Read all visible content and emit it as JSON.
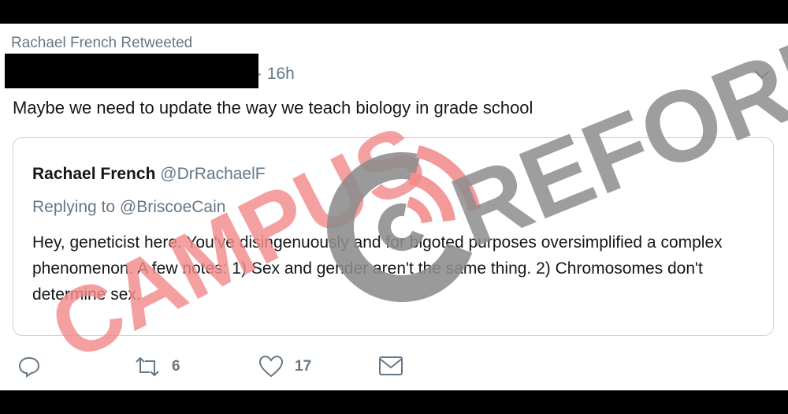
{
  "retweet_header": "Rachael French Retweeted",
  "tweet": {
    "time": "· 16h",
    "text": "Maybe we need to update the way we teach biology in grade school"
  },
  "quoted_tweet": {
    "name": "Rachael French",
    "handle": "@DrRachaelF",
    "replying_to_label": "Replying to",
    "replying_to_handle": "@BriscoeCain",
    "text": "Hey, geneticist here. You've disingenuously and for bigoted purposes oversimplified a complex phenomenon. A few notes: 1) Sex and gender aren't the same thing. 2) Chromosomes don't determine sex."
  },
  "actions": {
    "reply_icon": "reply-icon",
    "retweet_icon": "retweet-icon",
    "retweet_count": "6",
    "like_icon": "heart-icon",
    "like_count": "17",
    "message_icon": "envelope-icon"
  },
  "watermark": {
    "word1": "CAMPUS",
    "word2": "REFORM",
    "colors": {
      "red": "#f28b8b",
      "gray": "#8d8d8d"
    }
  }
}
